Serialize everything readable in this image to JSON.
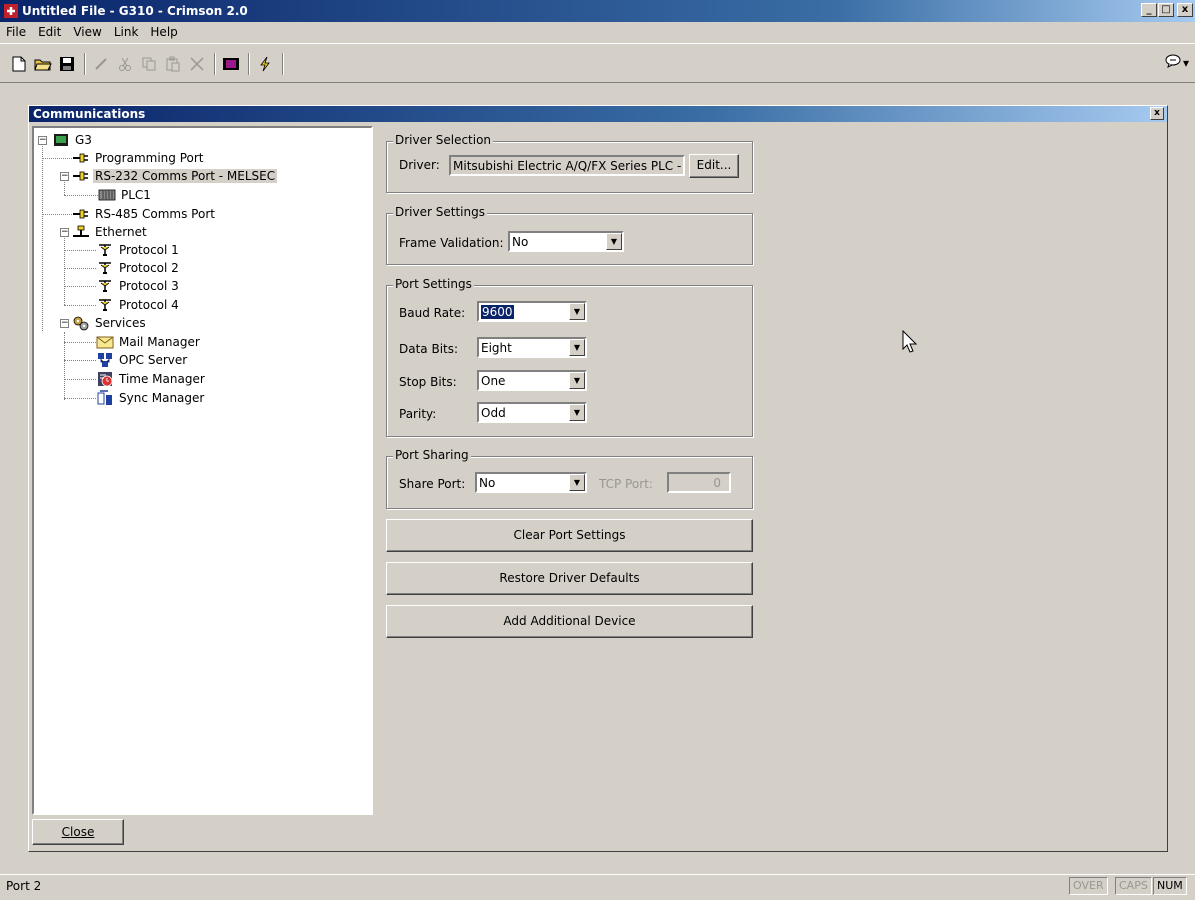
{
  "window": {
    "title": "Untitled File - G310 - Crimson 2.0",
    "min": "_",
    "max": "□",
    "close": "x"
  },
  "menu": [
    "File",
    "Edit",
    "View",
    "Link",
    "Help"
  ],
  "toolbar": {
    "help_dropdown": "▾"
  },
  "panel": {
    "title": "Communications",
    "close": "x",
    "tree": {
      "root": "G3",
      "programming_port": "Programming Port",
      "rs232": "RS-232 Comms Port - MELSEC",
      "plc1": "PLC1",
      "rs485": "RS-485 Comms Port",
      "ethernet": "Ethernet",
      "protocols": [
        "Protocol 1",
        "Protocol 2",
        "Protocol 3",
        "Protocol 4"
      ],
      "services": "Services",
      "service_items": [
        "Mail Manager",
        "OPC Server",
        "Time Manager",
        "Sync Manager"
      ]
    },
    "close_button": "Close"
  },
  "driver_selection": {
    "legend": "Driver Selection",
    "driver_label": "Driver:",
    "driver_value": "Mitsubishi Electric A/Q/FX Series PLC - ME",
    "edit_button": "Edit..."
  },
  "driver_settings": {
    "legend": "Driver Settings",
    "frame_validation_label": "Frame Validation:",
    "frame_validation_value": "No"
  },
  "port_settings": {
    "legend": "Port Settings",
    "baud_rate_label": "Baud Rate:",
    "baud_rate_value": "9600",
    "data_bits_label": "Data Bits:",
    "data_bits_value": "Eight",
    "stop_bits_label": "Stop Bits:",
    "stop_bits_value": "One",
    "parity_label": "Parity:",
    "parity_value": "Odd"
  },
  "port_sharing": {
    "legend": "Port Sharing",
    "share_port_label": "Share Port:",
    "share_port_value": "No",
    "tcp_port_label": "TCP Port:",
    "tcp_port_value": "0"
  },
  "buttons": {
    "clear_port_settings": "Clear Port Settings",
    "restore_driver_defaults": "Restore Driver Defaults",
    "add_additional_device": "Add Additional Device"
  },
  "status": {
    "text": "Port 2",
    "over": "OVER",
    "caps": "CAPS",
    "num": "NUM"
  }
}
